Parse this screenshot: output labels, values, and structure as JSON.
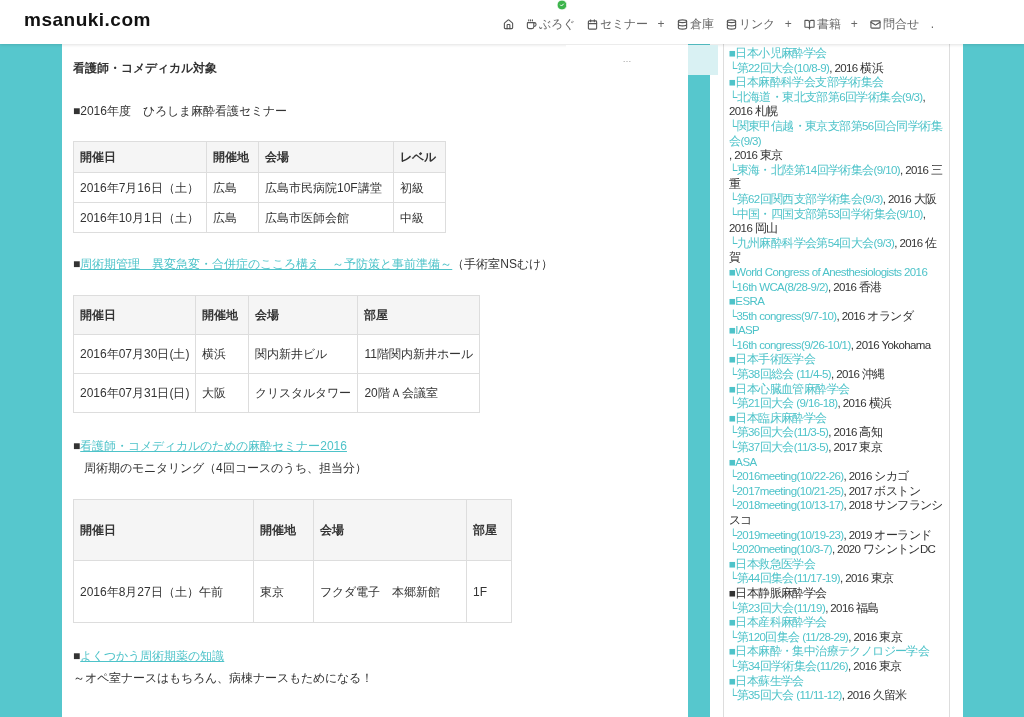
{
  "site": {
    "logo": "msanuki.com"
  },
  "nav": {
    "items": [
      {
        "has_submenu": false,
        "badge": false
      },
      {
        "label": "ぶろぐ",
        "has_submenu": false,
        "badge": true
      },
      {
        "label": "セミナー",
        "has_submenu": true,
        "badge": false
      },
      {
        "label": "倉庫",
        "has_submenu": false,
        "badge": false
      },
      {
        "label": "リンク",
        "has_submenu": true,
        "badge": false
      },
      {
        "label": "書籍",
        "has_submenu": true,
        "badge": false
      },
      {
        "label": "問合せ",
        "has_submenu": false,
        "badge": false
      },
      {
        "label": ".",
        "has_submenu": false,
        "badge": false
      }
    ],
    "submenu_marker": "+",
    "dropdown": {
      "text": "…"
    }
  },
  "content": {
    "heading": "看護師・コメディカル対象",
    "sections": [
      {
        "title": {
          "marker": "■",
          "text": "2016年度　ひろしま麻酔看護セミナー"
        },
        "table": {
          "columns": [
            "開催日",
            "開催地",
            "会場",
            "レベル"
          ],
          "rows": [
            [
              "2016年7月16日（土）",
              "広島",
              "広島市民病院10F講堂",
              "初級"
            ],
            [
              "2016年10月1日（土）",
              "広島",
              "広島市医師会館",
              "中級"
            ]
          ]
        }
      },
      {
        "title": {
          "marker": "■",
          "link": "周術期管理　異変急変・合併症のこころ構え　～予防策と事前準備～",
          "text": "（手術室NSむけ）"
        },
        "table": {
          "columns": [
            "開催日",
            "開催地",
            "会場",
            "部屋"
          ],
          "rows": [
            [
              "2016年07月30日(土)",
              "横浜",
              "関内新井ビル",
              "11階関内新井ホール"
            ],
            [
              "2016年07月31日(日)",
              "大阪",
              "クリスタルタワー",
              "20階Ａ会議室"
            ]
          ]
        }
      },
      {
        "title": {
          "marker": "■",
          "link": "看護師・コメディカルのための麻酔セミナー2016"
        },
        "subtitle": "周術期のモニタリング（4回コースのうち、担当分）",
        "table": {
          "columns": [
            "開催日",
            "開催地",
            "会場",
            "部屋"
          ],
          "rows": [
            [
              "2016年8月27日（土）午前",
              "東京",
              "フクダ電子　本郷新館",
              "1F"
            ]
          ]
        }
      },
      {
        "title": {
          "marker": "■",
          "link": "よくつかう周術期薬の知識"
        },
        "note": "～オペ室ナースはもちろん、病棟ナースもためになる！"
      }
    ]
  },
  "sidebar": {
    "entries": [
      {
        "kind": "heading",
        "label": "■日本小児麻酔学会",
        "linked": true
      },
      {
        "kind": "event",
        "link": "└第22回大会(10/8-9)",
        "text": ", 2016 横浜"
      },
      {
        "kind": "heading",
        "label": "■日本麻酔科学会支部学術集会",
        "linked": true
      },
      {
        "kind": "event",
        "link": "└北海道・東北支部第6回学術集会(9/3)",
        "text": ", 2016 札幌"
      },
      {
        "kind": "event",
        "link": "└関東甲信越・東京支部第56回合同学術集会(9/3)",
        "text": ", 2016 東京"
      },
      {
        "kind": "event",
        "link": "└東海・北陸第14回学術集会(9/10)",
        "text": ", 2016 三重"
      },
      {
        "kind": "event",
        "link": "└第62回関西支部学術集会(9/3)",
        "text": ", 2016 大阪"
      },
      {
        "kind": "event",
        "link": "└中国・四国支部第53回学術集会(9/10)",
        "text": ", 2016 岡山"
      },
      {
        "kind": "event",
        "link": "└九州麻酔科学会第54回大会(9/3)",
        "text": ", 2016 佐賀"
      },
      {
        "kind": "heading",
        "label": "■World Congress of Anesthesiologists 2016",
        "linked": true
      },
      {
        "kind": "event",
        "link": "└16th WCA(8/28-9/2)",
        "text": ", 2016 香港"
      },
      {
        "kind": "heading",
        "label": "■ESRA",
        "linked": true
      },
      {
        "kind": "event",
        "link": "└35th congress(9/7-10)",
        "text": ", 2016 オランダ"
      },
      {
        "kind": "heading",
        "label": "■IASP",
        "linked": true
      },
      {
        "kind": "event",
        "link": "└16th congress(9/26-10/1)",
        "text": ", 2016 Yokohama"
      },
      {
        "kind": "heading",
        "label": "■日本手術医学会",
        "linked": true
      },
      {
        "kind": "event",
        "link": "└第38回総会 (11/4-5)",
        "text": ", 2016 沖縄"
      },
      {
        "kind": "heading",
        "label": "■日本心臓血管麻酔学会",
        "linked": true
      },
      {
        "kind": "event",
        "link": "└第21回大会 (9/16-18)",
        "text": ", 2016 横浜"
      },
      {
        "kind": "heading",
        "label": "■日本臨床麻酔学会",
        "linked": true
      },
      {
        "kind": "event",
        "link": "└第36回大会(11/3-5)",
        "text": ", 2016 高知"
      },
      {
        "kind": "event",
        "link": "└第37回大会(11/3-5)",
        "text": ", 2017 東京"
      },
      {
        "kind": "heading",
        "label": "■ASA",
        "linked": true
      },
      {
        "kind": "event",
        "link": "└2016meeting(10/22-26)",
        "text": ", 2016 シカゴ"
      },
      {
        "kind": "event",
        "link": "└2017meeting(10/21-25)",
        "text": ", 2017 ボストン"
      },
      {
        "kind": "event",
        "link": "└2018meeting(10/13-17)",
        "text": ", 2018 サンフランシスコ"
      },
      {
        "kind": "event",
        "link": "└2019meeting(10/19-23)",
        "text": ", 2019 オーランド"
      },
      {
        "kind": "event",
        "link": "└2020meeting(10/3-7)",
        "text": ", 2020 ワシントンDC"
      },
      {
        "kind": "heading",
        "label": "■日本救急医学会",
        "linked": true
      },
      {
        "kind": "event",
        "link": "└第44回集会(11/17-19)",
        "text": ", 2016 東京"
      },
      {
        "kind": "heading",
        "label": "■日本静脈麻酔学会",
        "linked": false
      },
      {
        "kind": "event",
        "link": "└第23回大会(11/19)",
        "text": ", 2016 福島"
      },
      {
        "kind": "heading",
        "label": "■日本産科麻酔学会",
        "linked": true
      },
      {
        "kind": "event",
        "link": "└第120回集会 (11/28-29)",
        "text": ", 2016 東京"
      },
      {
        "kind": "heading",
        "label": "■日本麻酔・集中治療テクノロジー学会",
        "linked": true
      },
      {
        "kind": "event",
        "link": "└第34回学術集会(11/26)",
        "text": ", 2016 東京"
      },
      {
        "kind": "heading",
        "label": "■日本蘇生学会",
        "linked": true
      },
      {
        "kind": "event",
        "link": "└第35回大会 (11/11-12)",
        "text": ", 2016 久留米"
      }
    ]
  }
}
